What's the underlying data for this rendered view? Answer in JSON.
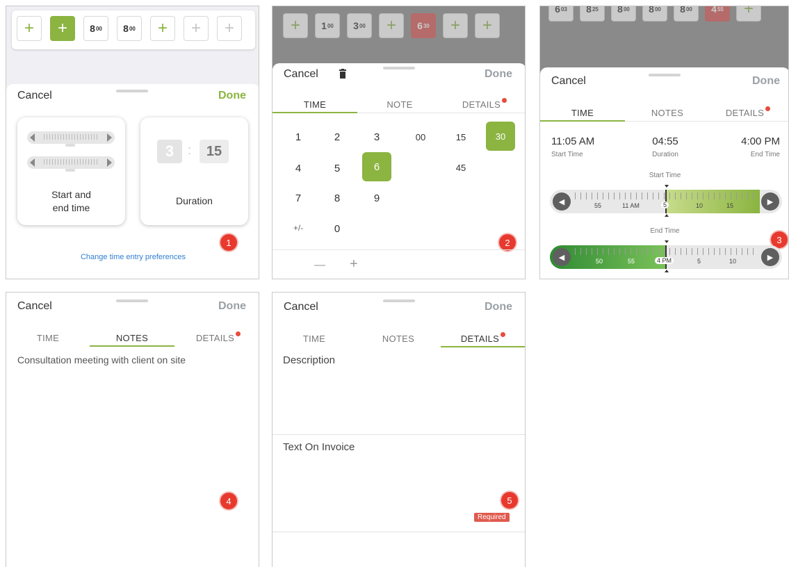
{
  "common": {
    "cancel": "Cancel",
    "done": "Done"
  },
  "panel1": {
    "tiles": [
      {
        "kind": "plus",
        "style": "green-outline"
      },
      {
        "kind": "plus",
        "style": "green-filled"
      },
      {
        "kind": "time",
        "main": "8",
        "sup": "00"
      },
      {
        "kind": "time",
        "main": "8",
        "sup": "00"
      },
      {
        "kind": "plus",
        "style": "green-outline"
      },
      {
        "kind": "plus",
        "style": "grey"
      },
      {
        "kind": "plus",
        "style": "grey"
      }
    ],
    "option_start_end": "Start and\nend time",
    "option_duration": "Duration",
    "duration_hours": "3",
    "duration_minutes": "15",
    "duration_sep": ":",
    "prefs_link": "Change time entry preferences",
    "badge": "1"
  },
  "panel2": {
    "tiles": [
      {
        "kind": "plus"
      },
      {
        "main": "1",
        "sup": "00"
      },
      {
        "main": "3",
        "sup": "00"
      },
      {
        "kind": "plus"
      },
      {
        "main": "6",
        "sup": "30",
        "red": true
      },
      {
        "kind": "plus"
      },
      {
        "kind": "plus"
      }
    ],
    "tabs": [
      "TIME",
      "NOTE",
      "DETAILS"
    ],
    "hours": [
      "1",
      "2",
      "3",
      "4",
      "5",
      "6",
      "7",
      "8",
      "9",
      "+/-",
      "0"
    ],
    "selected_hour": "6",
    "minutes": [
      "00",
      "15",
      "30",
      "45"
    ],
    "selected_minute": "30",
    "minus": "—",
    "plus": "+",
    "badge": "2"
  },
  "panel3": {
    "tiles": [
      {
        "main": "6",
        "sup": "03"
      },
      {
        "main": "8",
        "sup": "25"
      },
      {
        "main": "8",
        "sup": "00"
      },
      {
        "main": "8",
        "sup": "00"
      },
      {
        "main": "8",
        "sup": "00"
      },
      {
        "main": "4",
        "sup": "55",
        "red": true
      },
      {
        "kind": "plus"
      }
    ],
    "tabs": [
      "TIME",
      "NOTES",
      "DETAILS"
    ],
    "start_value": "11:05 AM",
    "start_label": "Start Time",
    "duration_value": "04:55",
    "duration_label": "Duration",
    "end_value": "4:00 PM",
    "end_label": "End Time",
    "start_slider_title": "Start Time",
    "start_ticks": [
      "55",
      "11 AM",
      "5",
      "10",
      "15"
    ],
    "end_slider_title": "End Time",
    "end_ticks": [
      "50",
      "55",
      "4 PM",
      "5",
      "10"
    ],
    "badge": "3"
  },
  "panel4": {
    "tabs": [
      "TIME",
      "NOTES",
      "DETAILS"
    ],
    "note_text": "Consultation meeting with client on site",
    "badge": "4"
  },
  "panel5": {
    "tabs": [
      "TIME",
      "NOTES",
      "DETAILS"
    ],
    "description_label": "Description",
    "invoice_label": "Text On Invoice",
    "required": "Required",
    "badge": "5"
  },
  "colors": {
    "accent": "#8bb441",
    "alert": "#e8392e",
    "link": "#2f7fd1"
  }
}
